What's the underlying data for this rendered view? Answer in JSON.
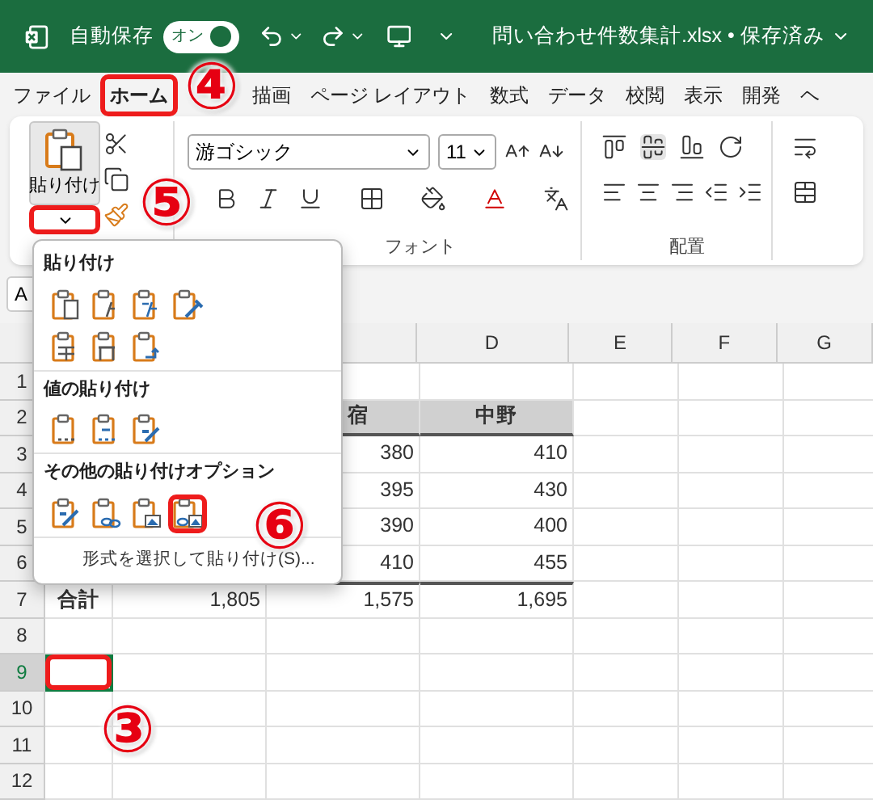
{
  "title_bar": {
    "autosave_label": "自動保存",
    "autosave_toggle": {
      "label": "オン",
      "on": true
    },
    "document_title": "問い合わせ件数集計.xlsx • 保存済み"
  },
  "ribbon_tabs": [
    {
      "label": "ファイル",
      "selected": false,
      "highlighted": false
    },
    {
      "label": "ホーム",
      "selected": true,
      "highlighted": true
    },
    {
      "label": "描画",
      "selected": false,
      "highlighted": false
    },
    {
      "label": "ページ レイアウト",
      "selected": false,
      "highlighted": false
    },
    {
      "label": "数式",
      "selected": false,
      "highlighted": false
    },
    {
      "label": "データ",
      "selected": false,
      "highlighted": false
    },
    {
      "label": "校閲",
      "selected": false,
      "highlighted": false
    },
    {
      "label": "表示",
      "selected": false,
      "highlighted": false
    },
    {
      "label": "開発",
      "selected": false,
      "highlighted": false
    },
    {
      "label": "ヘ",
      "selected": false,
      "highlighted": false
    }
  ],
  "ribbon": {
    "paste_button": {
      "label": "貼り付け",
      "pressed": true,
      "arrow_highlighted": true
    },
    "font_name": "游ゴシック",
    "font_size": "11",
    "groups": [
      "フォント",
      "配置"
    ]
  },
  "name_box": "A",
  "columns": [
    null,
    null,
    null,
    "D",
    "E",
    "F",
    "G"
  ],
  "rows": [
    {
      "number": "1",
      "kind": "blank",
      "selected": false,
      "cells": [
        null,
        null,
        null,
        null,
        null,
        null,
        null
      ]
    },
    {
      "number": "2",
      "kind": "header",
      "selected": false,
      "cells": [
        null,
        null,
        "宿",
        "中野",
        null,
        null,
        null
      ]
    },
    {
      "number": "3",
      "kind": "data",
      "selected": false,
      "cells": [
        null,
        null,
        "380",
        "410",
        null,
        null,
        null
      ]
    },
    {
      "number": "4",
      "kind": "data",
      "selected": false,
      "cells": [
        null,
        null,
        "395",
        "430",
        null,
        null,
        null
      ]
    },
    {
      "number": "5",
      "kind": "data",
      "selected": false,
      "cells": [
        null,
        null,
        "390",
        "400",
        null,
        null,
        null
      ]
    },
    {
      "number": "6",
      "kind": "data",
      "selected": false,
      "cells": [
        null,
        null,
        "410",
        "455",
        null,
        null,
        null
      ]
    },
    {
      "number": "7",
      "kind": "total",
      "selected": false,
      "cells": [
        "合計",
        "1,805",
        "1,575",
        "1,695",
        null,
        null,
        null
      ]
    },
    {
      "number": "8",
      "kind": "blank",
      "selected": false,
      "cells": [
        null,
        null,
        null,
        null,
        null,
        null,
        null
      ]
    },
    {
      "number": "9",
      "kind": "blank",
      "selected": true,
      "highlighted": true,
      "cells": [
        null,
        null,
        null,
        null,
        null,
        null,
        null
      ]
    },
    {
      "number": "10",
      "kind": "blank",
      "selected": false,
      "cells": [
        null,
        null,
        null,
        null,
        null,
        null,
        null
      ]
    },
    {
      "number": "11",
      "kind": "blank",
      "selected": false,
      "cells": [
        null,
        null,
        null,
        null,
        null,
        null,
        null
      ]
    },
    {
      "number": "12",
      "kind": "blank",
      "selected": false,
      "cells": [
        null,
        null,
        null,
        null,
        null,
        null,
        null
      ]
    }
  ],
  "paste_menu": {
    "sections": [
      {
        "title": "貼り付け",
        "options": [
          {
            "kind": "paste",
            "highlighted": false
          },
          {
            "kind": "formula",
            "highlighted": false
          },
          {
            "kind": "formula_format",
            "highlighted": false
          },
          {
            "kind": "keep_source",
            "highlighted": false
          },
          {
            "kind": "no_borders",
            "highlighted": false
          },
          {
            "kind": "column_width",
            "highlighted": false
          },
          {
            "kind": "transpose",
            "highlighted": false
          }
        ]
      },
      {
        "title": "値の貼り付け",
        "options": [
          {
            "kind": "values",
            "highlighted": false
          },
          {
            "kind": "values_format",
            "highlighted": false
          },
          {
            "kind": "values_source",
            "highlighted": false
          }
        ]
      },
      {
        "title": "その他の貼り付けオプション",
        "options": [
          {
            "kind": "formatting",
            "highlighted": false
          },
          {
            "kind": "link",
            "highlighted": false
          },
          {
            "kind": "picture",
            "highlighted": false
          },
          {
            "kind": "linked_picture",
            "highlighted": true
          }
        ]
      }
    ],
    "footer": "形式を選択して貼り付け(S)..."
  },
  "callouts": {
    "tabs": "④",
    "paste": "⑤",
    "option": "⑥",
    "cell": "③"
  }
}
